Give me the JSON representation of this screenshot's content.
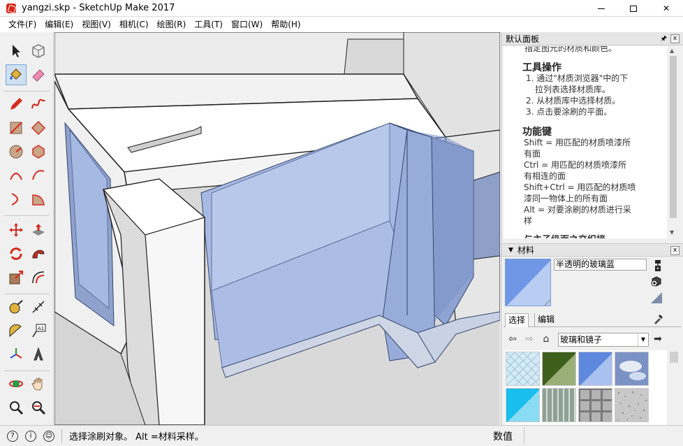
{
  "window": {
    "title": "yangzi.skp - SketchUp Make 2017",
    "minimize_glyph": "minimize",
    "maximize_glyph": "maximize",
    "close_glyph": "✕"
  },
  "menu": [
    "文件(F)",
    "编辑(E)",
    "视图(V)",
    "相机(C)",
    "绘图(R)",
    "工具(T)",
    "窗口(W)",
    "帮助(H)"
  ],
  "toolbar": {
    "tools": [
      "select-icon",
      "component-icon",
      "paint-bucket-icon",
      "eraser-icon",
      "pencil-icon",
      "freehand-icon",
      "rectangle-icon",
      "rotated-rectangle-icon",
      "circle-icon",
      "polygon-icon",
      "arc-icon",
      "arc-2-icon",
      "arc-3-icon",
      "pie-icon",
      "move-icon",
      "push-pull-icon",
      "rotate-icon",
      "follow-me-icon",
      "scale-icon",
      "offset-icon",
      "tape-measure-icon",
      "dimension-icon",
      "protractor-icon",
      "text-icon",
      "axes-icon",
      "3d-text-icon",
      "orbit-icon",
      "pan-icon",
      "zoom-icon",
      "zoom-extents-icon"
    ],
    "active_tool": "paint-bucket-icon"
  },
  "default_tray": {
    "title": "默认面板",
    "pin_glyph": "🖈",
    "close_glyph": "x"
  },
  "instructor": {
    "cut_top_line": "指定图元的材质和颜色。",
    "section1_title": "工具操作",
    "section1_lines": [
      "1. 通过\"材质浏览器\"中的下",
      "拉列表选择材质库。",
      "2. 从材质库中选择材质。",
      "3. 点击要涂刷的平面。"
    ],
    "section2_title": "功能键",
    "section2_lines": [
      "Shift = 用匹配的材质喷漆所",
      "有面",
      "Ctrl = 用匹配的材质喷漆所",
      "有相连的面",
      "Shift+Ctrl = 用匹配的材质喷",
      "漆同一物体上的所有面",
      "Alt = 对要涂刷的材质进行采",
      "样"
    ],
    "cut_bottom_line": "与主子级面之交织接"
  },
  "materials": {
    "panel_title": "材料",
    "collapse_glyph": "▼",
    "close_glyph": "x",
    "current_name": "半透明的玻璃蓝",
    "current_color": "#6f97e6",
    "tabs": [
      "选择",
      "编辑"
    ],
    "collection": "玻璃和镜子",
    "swatches": [
      {
        "name": "glass-diamond",
        "color": "#cfe6f2"
      },
      {
        "name": "green-glass",
        "color": "#3e5e1c"
      },
      {
        "name": "blue-glass",
        "color": "#6f97e6"
      },
      {
        "name": "sky-glass",
        "color": "#8fa6d0"
      },
      {
        "name": "cyan-glass",
        "color": "#2fc4ef"
      },
      {
        "name": "ribbed-glass",
        "color": "#8a9a8e"
      },
      {
        "name": "block-glass",
        "color": "#8a8a8a"
      },
      {
        "name": "frosted-glass",
        "color": "#c2c2c2"
      }
    ]
  },
  "status": {
    "message": "选择涂刷对象。 Alt =材料采样。",
    "measurements_label": "数值",
    "measurements_value": ""
  },
  "colors": {
    "glass_blue": "#a6b9e2",
    "wall_white": "#f4f4f4",
    "accent_red": "#d32b1e"
  }
}
